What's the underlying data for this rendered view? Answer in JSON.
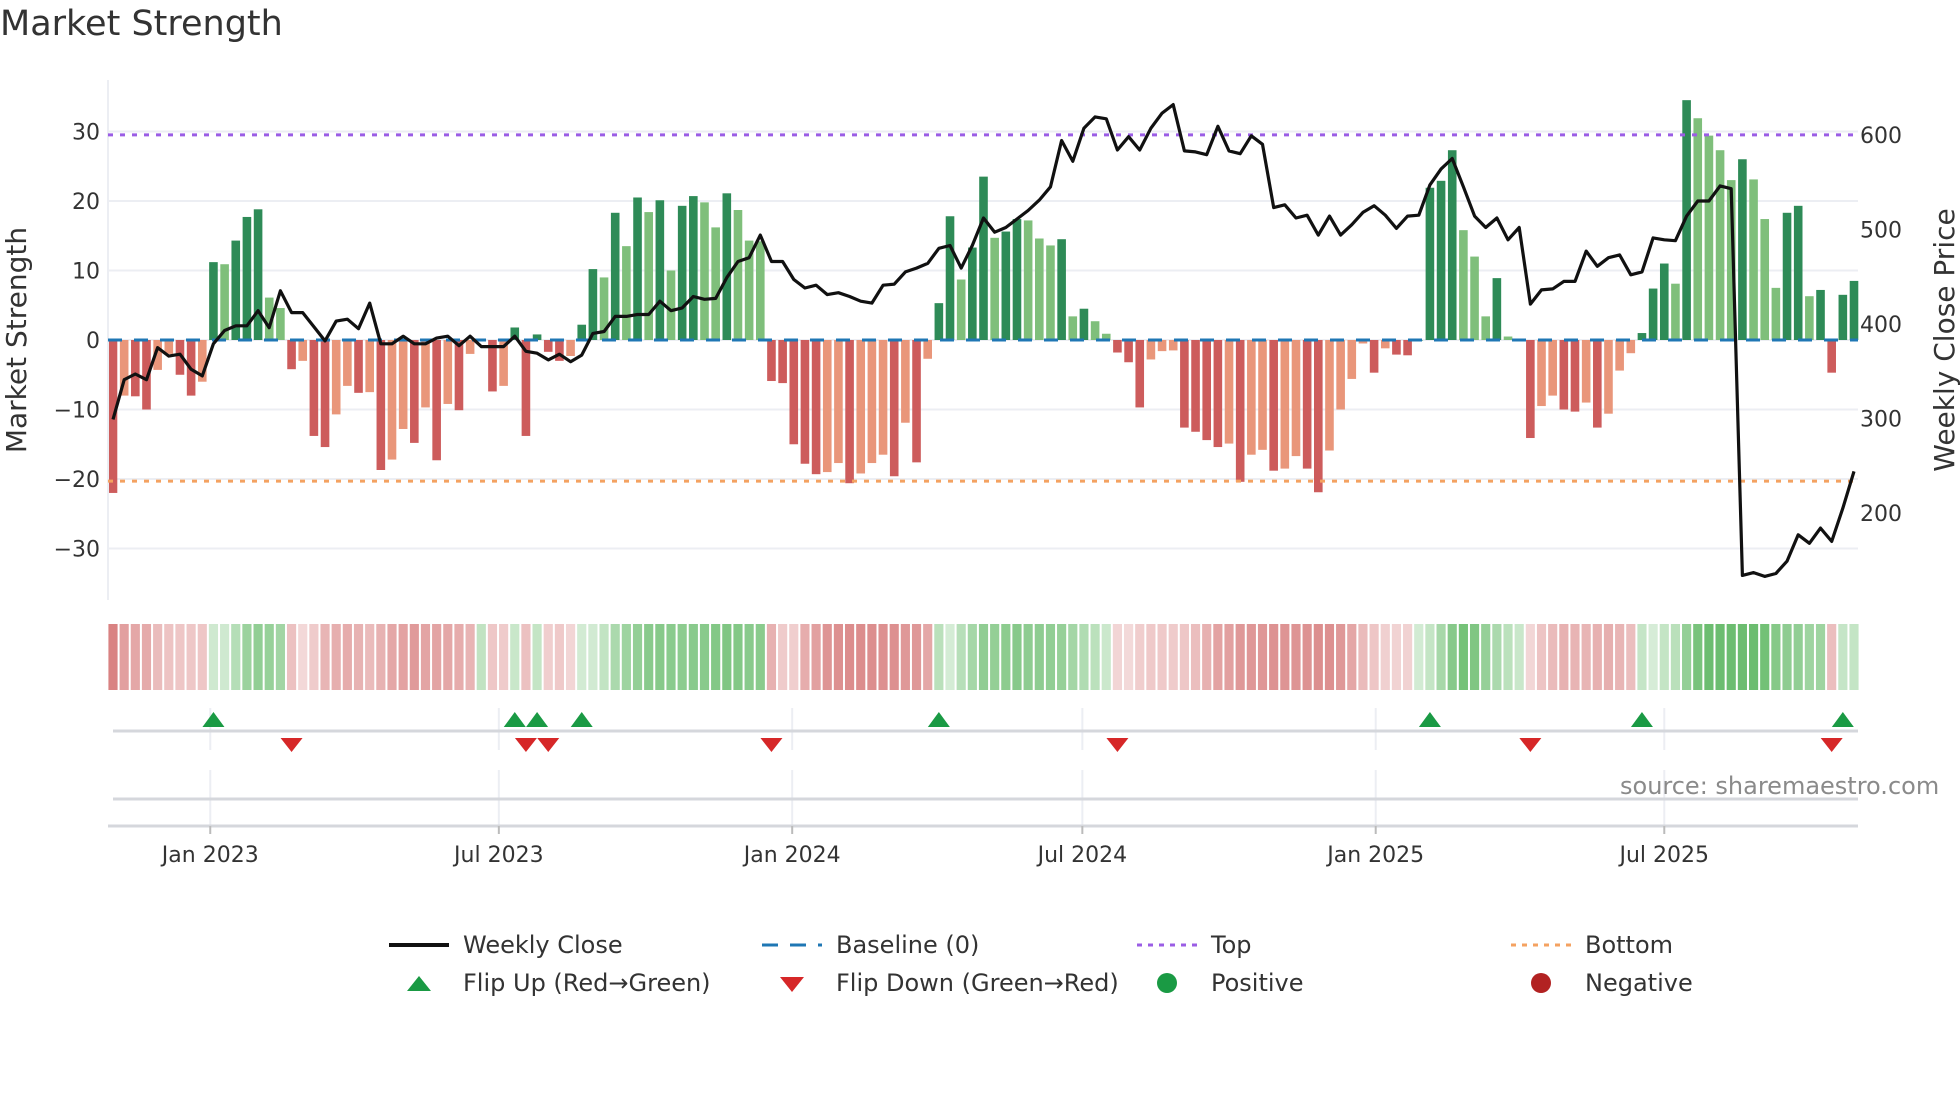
{
  "title": "Market Strength",
  "source": "source: sharemaestro.com",
  "legend": {
    "weekly_close": "Weekly Close",
    "baseline": "Baseline (0)",
    "top": "Top",
    "bottom": "Bottom",
    "flip_up": "Flip Up (Red→Green)",
    "flip_down": "Flip Down (Green→Red)",
    "positive": "Positive",
    "negative": "Negative"
  },
  "colors": {
    "pos_dark": "#2e8b57",
    "pos_light": "#7fbf7b",
    "neg_dark": "#cd5c5c",
    "neg_light": "#e9967a",
    "line": "#111111",
    "baseline": "#1f77b4",
    "top": "#9b5de5",
    "bottom": "#f4a261",
    "flip_up": "#1a9a44",
    "flip_down": "#d62728",
    "positive": "#1a9a44",
    "negative": "#b22222",
    "strip_pos": "76,175,80",
    "strip_neg": "205,92,92"
  },
  "chart_data": {
    "type": "bar+line",
    "title": "Market Strength",
    "ylabel": "Market Strength",
    "y2label": "Weekly Close Price",
    "ylim": [
      -37.4,
      37.4
    ],
    "y2lim": [
      108,
      658
    ],
    "yticks": [
      -30,
      -20,
      -10,
      0,
      10,
      20,
      30
    ],
    "ytick_labels": [
      "−30",
      "−20",
      "−10",
      "0",
      "10",
      "20",
      "30"
    ],
    "y2ticks": [
      200,
      300,
      400,
      500,
      600
    ],
    "y2tick_labels": [
      "200",
      "300",
      "400",
      "500",
      "600"
    ],
    "x_start": "2022-11-01",
    "x_step_days": 7,
    "x_end": "2025-10-21",
    "xticks": [
      "2023-01-01",
      "2023-07-01",
      "2024-01-01",
      "2024-07-01",
      "2025-01-01",
      "2025-07-01"
    ],
    "xtick_labels": [
      "Jan 2023",
      "Jul 2023",
      "Jan 2024",
      "Jul 2024",
      "Jan 2025",
      "Jul 2025"
    ],
    "top_level": 29.5,
    "bottom_level": -20.3,
    "baseline_level": 0,
    "strength": [
      -22,
      -8,
      -8.1,
      -10,
      -4.3,
      -2,
      -5,
      -8,
      -6,
      11.2,
      10.9,
      14.3,
      17.7,
      18.8,
      6.1,
      4.6,
      -4.2,
      -3,
      -13.8,
      -15.4,
      -10.7,
      -6.6,
      -7.6,
      -7.5,
      -18.7,
      -17.2,
      -12.8,
      -14.8,
      -9.7,
      -17.3,
      -9.2,
      -10.1,
      -2,
      0,
      -7.4,
      -6.6,
      1.8,
      -13.8,
      0.8,
      -1.7,
      -3,
      -2.3,
      2.2,
      10.2,
      9,
      18.3,
      13.5,
      20.5,
      18.4,
      20.1,
      10,
      19.3,
      20.7,
      19.8,
      16.2,
      21.1,
      18.7,
      14.3,
      14.2,
      -5.9,
      -6.2,
      -15,
      -17.8,
      -19.3,
      -19,
      -17.7,
      -20.6,
      -19.2,
      -17.7,
      -16.5,
      -19.6,
      -11.9,
      -17.6,
      -2.7,
      5.3,
      17.8,
      8.7,
      13.3,
      23.5,
      14.7,
      15.6,
      17.4,
      17.2,
      14.6,
      13.6,
      14.5,
      3.4,
      4.5,
      2.7,
      0.9,
      -1.8,
      -3.2,
      -9.7,
      -2.8,
      -1.6,
      -1.5,
      -12.6,
      -13.2,
      -14.4,
      -15.4,
      -14.9,
      -20.4,
      -16.5,
      -15.8,
      -18.8,
      -18.5,
      -16.7,
      -18.5,
      -21.9,
      -15.9,
      -10,
      -5.6,
      -0.5,
      -4.7,
      -1.2,
      -2.1,
      -2.2,
      0,
      21.9,
      22.9,
      27.3,
      15.8,
      12,
      3.4,
      8.9,
      0.5,
      0,
      -14.1,
      -9.5,
      -8,
      -10,
      -10.3,
      -9,
      -12.6,
      -10.6,
      -4.4,
      -1.9,
      1,
      7.4,
      11,
      8.1,
      34.5,
      31.9,
      29.4,
      27.3,
      23,
      26,
      23.1,
      17.4,
      7.5,
      18.3,
      19.3,
      6.3,
      7.2,
      -4.7,
      6.5,
      8.5
    ],
    "weekly_close": [
      299,
      341,
      347,
      341,
      375,
      366,
      368,
      352,
      345,
      379,
      393,
      398,
      398,
      414,
      396,
      435,
      412,
      412,
      397,
      382,
      403,
      405,
      395,
      422,
      379,
      379,
      387,
      379,
      379,
      385,
      387,
      377,
      387,
      376,
      376,
      376,
      387,
      371,
      369,
      362,
      368,
      360,
      367,
      390,
      392,
      408,
      408,
      410,
      410,
      424,
      414,
      417,
      429,
      426,
      427,
      449,
      466,
      470,
      494,
      466,
      466,
      447,
      438,
      441,
      431,
      433,
      429,
      424,
      422,
      441,
      442,
      455,
      459,
      464,
      480,
      483,
      459,
      483,
      512,
      497,
      502,
      511,
      520,
      531,
      545,
      594,
      572,
      607,
      619,
      617,
      584,
      598,
      584,
      607,
      623,
      632,
      583,
      582,
      579,
      609,
      583,
      580,
      599,
      590,
      523,
      526,
      512,
      515,
      494,
      514,
      494,
      505,
      518,
      525,
      515,
      501,
      514,
      515,
      547,
      564,
      575,
      545,
      514,
      502,
      512,
      489,
      502,
      421,
      436,
      437,
      445,
      445,
      477,
      461,
      470,
      473,
      452,
      455,
      491,
      489,
      488,
      514,
      530,
      530,
      546,
      543,
      134,
      137,
      133,
      136,
      149,
      177,
      168,
      184,
      170,
      205,
      244
    ]
  }
}
